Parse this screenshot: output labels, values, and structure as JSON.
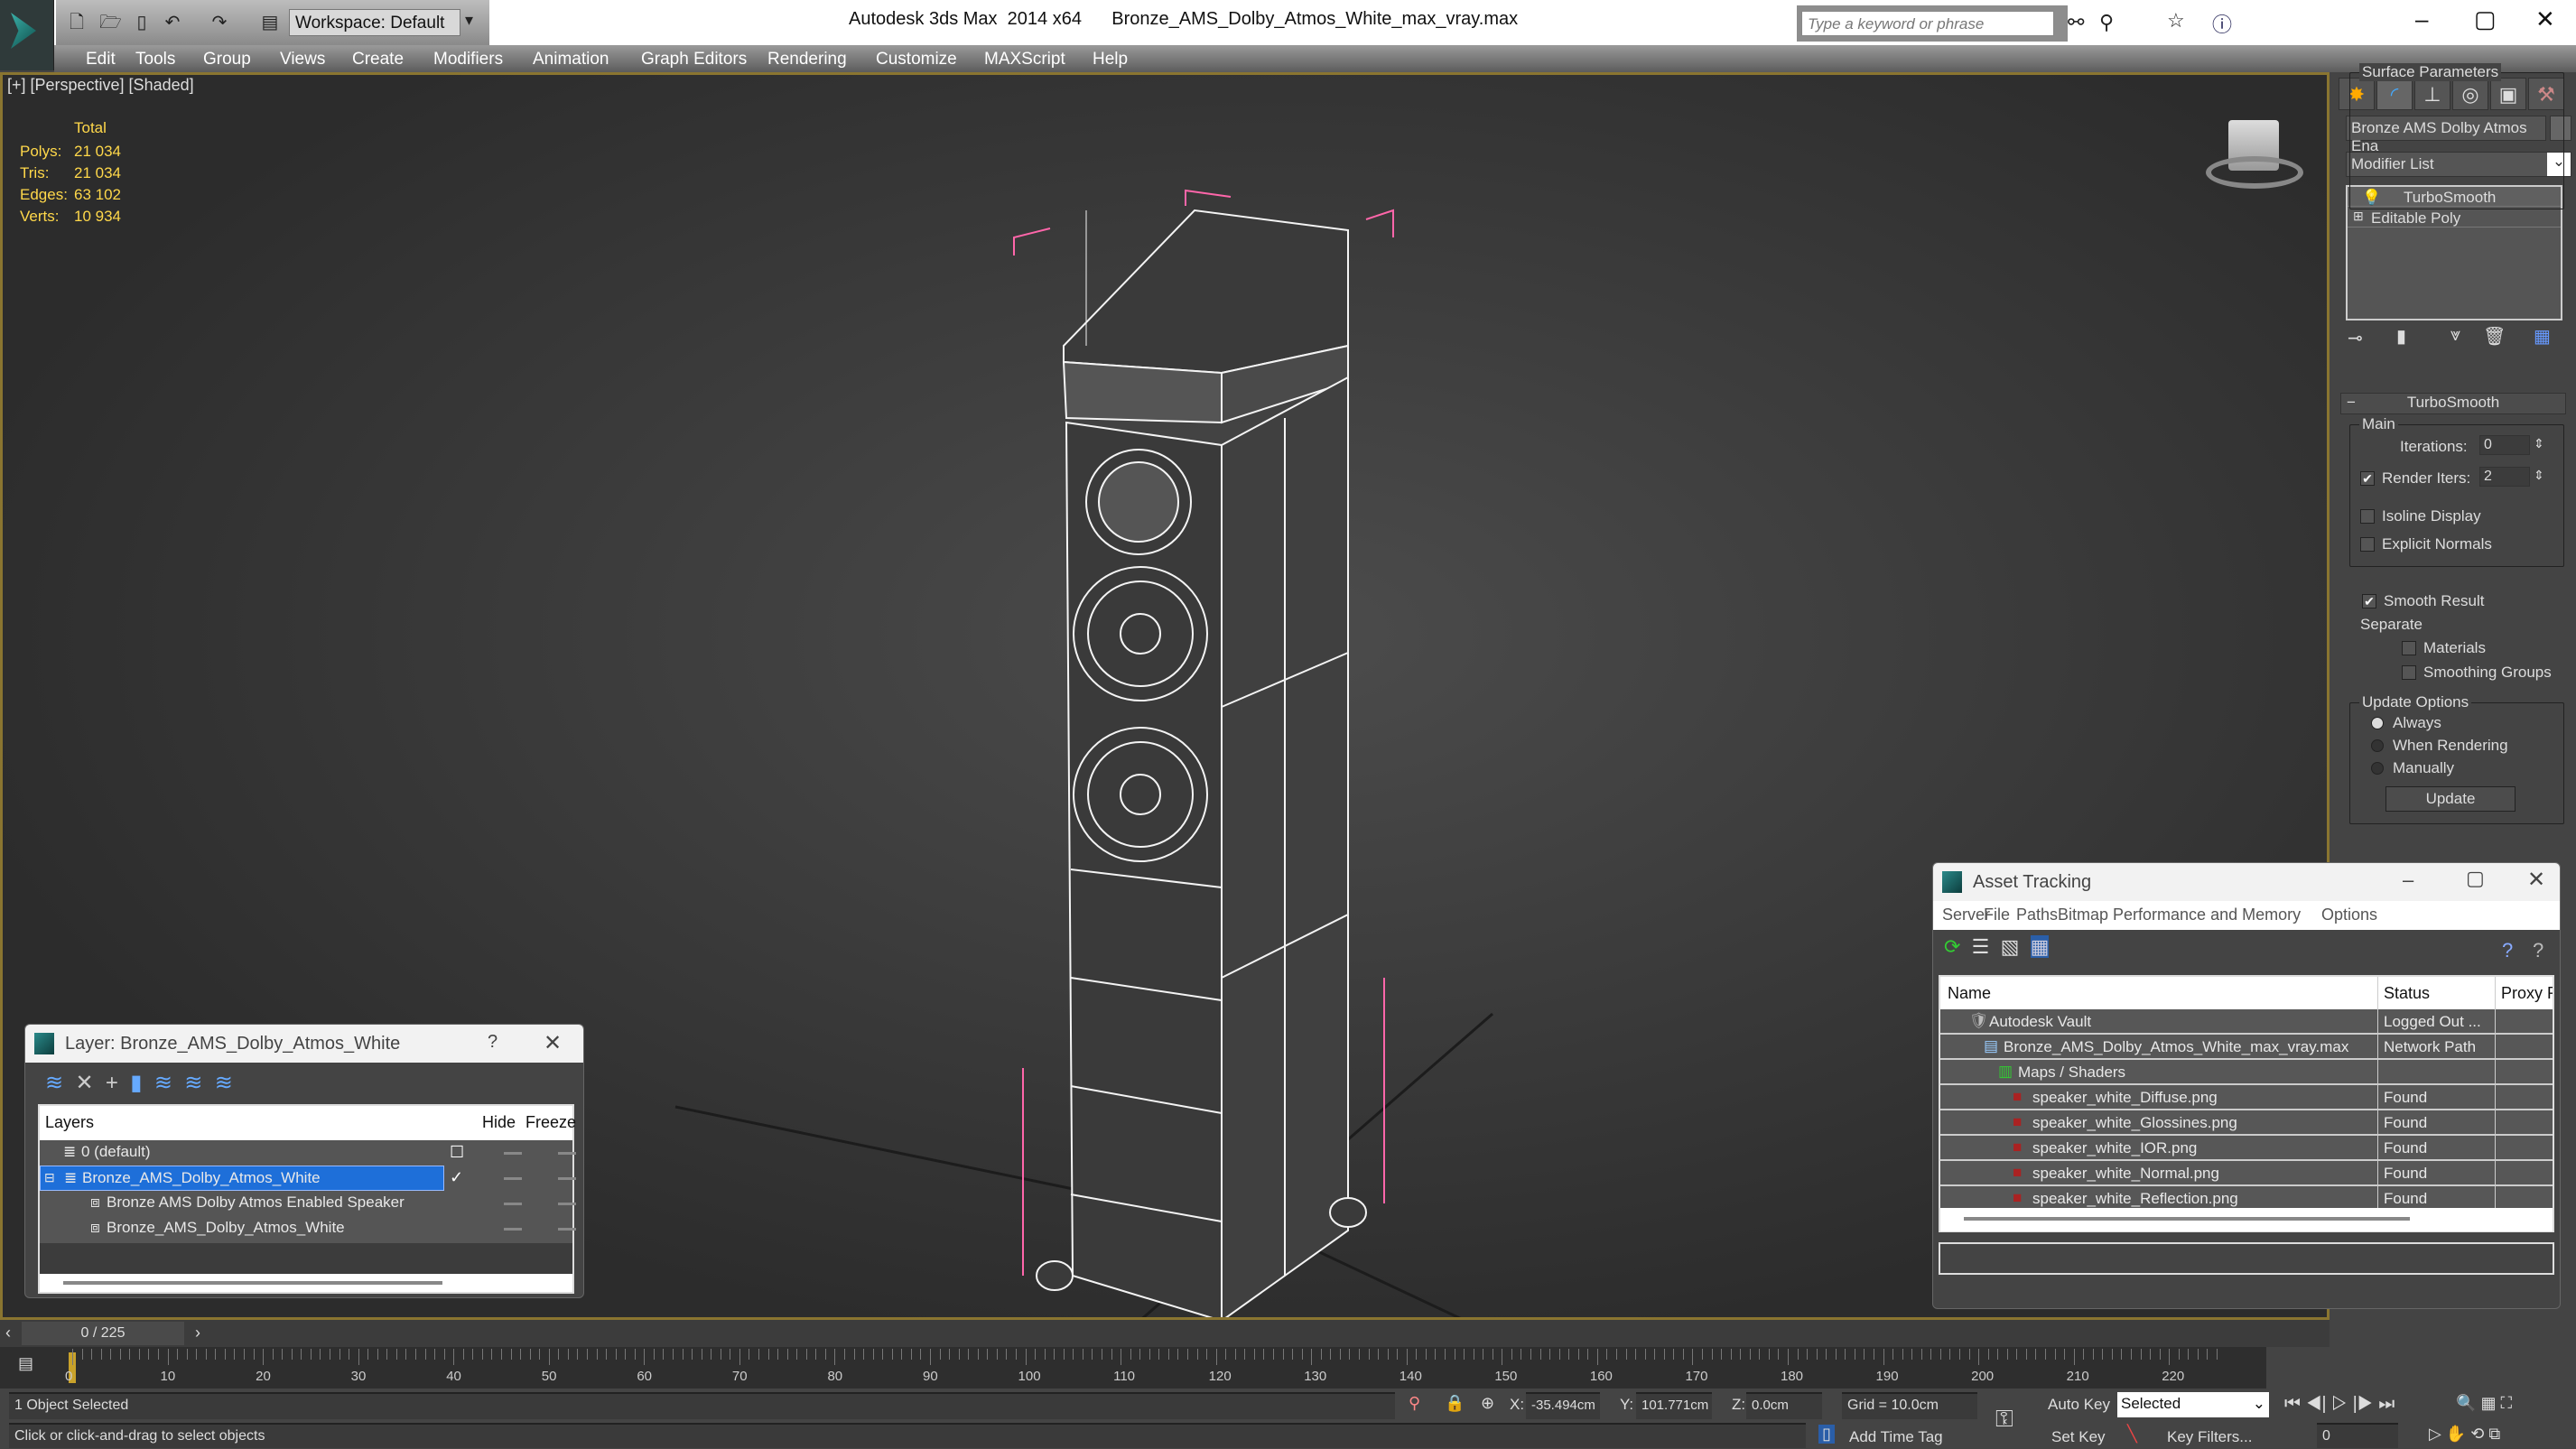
{
  "app": {
    "title": "Autodesk 3ds Max  2014 x64",
    "file": "Bronze_AMS_Dolby_Atmos_White_max_vray.max",
    "workspace": "Workspace: Default",
    "search_placeholder": "Type a keyword or phrase"
  },
  "menu": [
    "Edit",
    "Tools",
    "Group",
    "Views",
    "Create",
    "Modifiers",
    "Animation",
    "Graph Editors",
    "Rendering",
    "Customize",
    "MAXScript",
    "Help"
  ],
  "viewport": {
    "label": "[+] [Perspective] [Shaded]",
    "stats_header": "Total",
    "stats": [
      {
        "k": "Polys:",
        "v": "21 034"
      },
      {
        "k": "Tris:",
        "v": "21 034"
      },
      {
        "k": "Edges:",
        "v": "63 102"
      },
      {
        "k": "Verts:",
        "v": "10 934"
      }
    ],
    "accent": "#8a7530"
  },
  "command_panel": {
    "object_name": "Bronze AMS Dolby Atmos Ena",
    "modifier_list": "Modifier List",
    "stack": [
      "TurboSmooth",
      "Editable Poly"
    ],
    "rollout": "TurboSmooth",
    "main": "Main",
    "iterations_label": "Iterations:",
    "iterations": "0",
    "render_iters_label": "Render Iters:",
    "render_iters": "2",
    "render_iters_checked": true,
    "isoline": "Isoline Display",
    "explicit": "Explicit Normals",
    "surface": "Surface Parameters",
    "smooth_result": "Smooth Result",
    "smooth_checked": true,
    "separate": "Separate",
    "materials": "Materials",
    "smoothing_groups": "Smoothing Groups",
    "update_options": "Update Options",
    "radios": [
      "Always",
      "When Rendering",
      "Manually"
    ],
    "selected_radio": "Always",
    "update_button": "Update"
  },
  "layer_dialog": {
    "title": "Layer: Bronze_AMS_Dolby_Atmos_White",
    "help": "?",
    "col_layers": "Layers",
    "col_hide": "Hide",
    "col_freeze": "Freeze",
    "rows": [
      {
        "name": "0 (default)",
        "level": 0
      },
      {
        "name": "Bronze_AMS_Dolby_Atmos_White",
        "level": 0,
        "selected": true,
        "current": true
      },
      {
        "name": "Bronze AMS Dolby Atmos Enabled Speaker",
        "level": 1
      },
      {
        "name": "Bronze_AMS_Dolby_Atmos_White",
        "level": 1
      }
    ]
  },
  "asset_tracking": {
    "title": "Asset Tracking",
    "menu": [
      "Server",
      "File",
      "Paths",
      "Bitmap Performance and Memory",
      "Options"
    ],
    "col_name": "Name",
    "col_status": "Status",
    "col_proxy": "Proxy Re",
    "rows": [
      {
        "name": "Autodesk Vault",
        "status": "Logged Out ...",
        "level": 1
      },
      {
        "name": "Bronze_AMS_Dolby_Atmos_White_max_vray.max",
        "status": "Network Path",
        "level": 2
      },
      {
        "name": "Maps / Shaders",
        "status": "",
        "level": 3
      },
      {
        "name": "speaker_white_Diffuse.png",
        "status": "Found",
        "level": 4
      },
      {
        "name": "speaker_white_Glossines.png",
        "status": "Found",
        "level": 4
      },
      {
        "name": "speaker_white_IOR.png",
        "status": "Found",
        "level": 4
      },
      {
        "name": "speaker_white_Normal.png",
        "status": "Found",
        "level": 4
      },
      {
        "name": "speaker_white_Reflection.png",
        "status": "Found",
        "level": 4
      }
    ]
  },
  "timeline": {
    "frame": "0 / 225",
    "ticks": [
      "0",
      "10",
      "20",
      "30",
      "40",
      "50",
      "60",
      "70",
      "80",
      "90",
      "100",
      "110",
      "120",
      "130",
      "140",
      "150",
      "160",
      "170",
      "180",
      "190",
      "200",
      "210",
      "220"
    ]
  },
  "status": {
    "selection": "1 Object Selected",
    "prompt": "Click or click-and-drag to select objects",
    "x": "-35.494cm",
    "y": "101.771cm",
    "z": "0.0cm",
    "grid": "Grid = 10.0cm",
    "add_time_tag": "Add Time Tag",
    "auto_key": "Auto Key",
    "set_key": "Set Key",
    "key_mode": "Selected",
    "key_filters": "Key Filters...",
    "frame_field": "0"
  }
}
